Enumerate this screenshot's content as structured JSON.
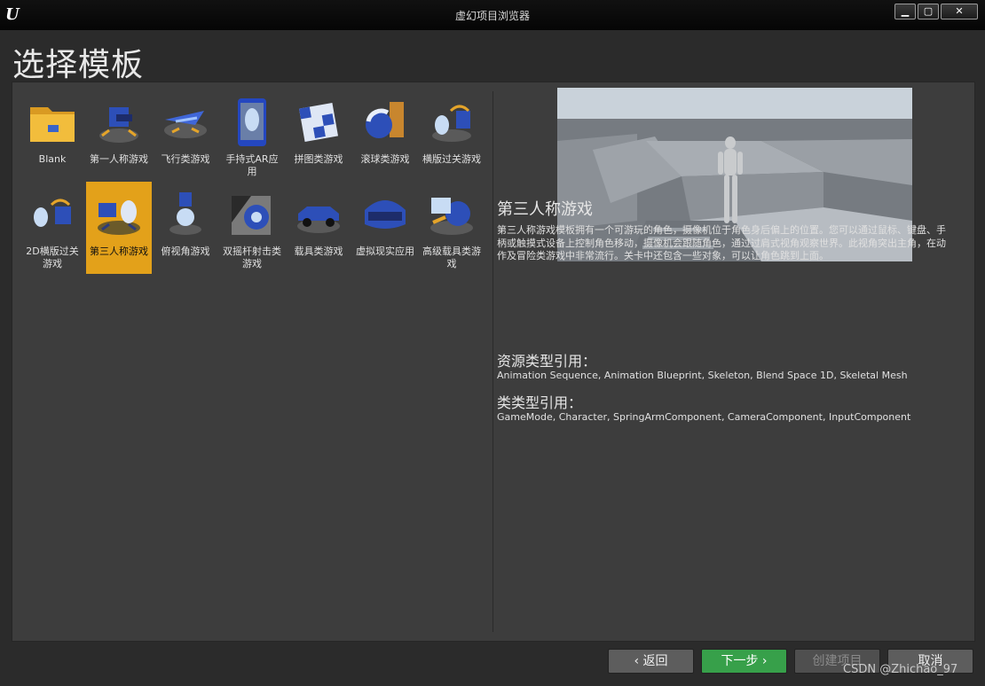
{
  "window": {
    "logo": "U",
    "title": "虚幻项目浏览器",
    "controls": {
      "minimize": "▁",
      "maximize": "▢",
      "close": "✕"
    }
  },
  "page_heading": "选择模板",
  "templates": [
    {
      "label": "Blank",
      "icon": "folder-icon"
    },
    {
      "label": "第一人称游戏",
      "icon": "first-person-icon"
    },
    {
      "label": "飞行类游戏",
      "icon": "flying-icon"
    },
    {
      "label": "手持式AR应用",
      "icon": "handheld-ar-icon"
    },
    {
      "label": "拼图类游戏",
      "icon": "puzzle-icon"
    },
    {
      "label": "滚球类游戏",
      "icon": "rolling-ball-icon"
    },
    {
      "label": "横版过关游戏",
      "icon": "side-scroller-icon"
    },
    {
      "label": "2D横版过关游戏",
      "icon": "2d-side-scroller-icon"
    },
    {
      "label": "第三人称游戏",
      "icon": "third-person-icon",
      "selected": true
    },
    {
      "label": "俯视角游戏",
      "icon": "top-down-icon"
    },
    {
      "label": "双摇杆射击类游戏",
      "icon": "twin-stick-icon"
    },
    {
      "label": "载具类游戏",
      "icon": "vehicle-icon"
    },
    {
      "label": "虚拟现实应用",
      "icon": "vr-headset-icon"
    },
    {
      "label": "高级载具类游戏",
      "icon": "advanced-vehicle-icon"
    }
  ],
  "detail": {
    "title": "第三人称游戏",
    "description": "第三人称游戏模板拥有一个可游玩的角色，摄像机位于角色身后偏上的位置。您可以通过鼠标、键盘、手柄或触摸式设备上控制角色移动，摄像机会跟随角色，通过过肩式视角观察世界。此视角突出主角，在动作及冒险类游戏中非常流行。关卡中还包含一些对象，可以让角色跳到上面。",
    "asset_heading": "资源类型引用：",
    "asset_types": "Animation Sequence, Animation Blueprint, Skeleton, Blend Space 1D, Skeletal Mesh",
    "class_heading": "类类型引用：",
    "class_types": "GameMode, Character, SpringArmComponent, CameraComponent, InputComponent"
  },
  "buttons": {
    "back": "‹ 返回",
    "next": "下一步 ›",
    "create": "创建项目",
    "cancel": "取消"
  },
  "watermark": "CSDN @Zhichao_97",
  "colors": {
    "selected_tile": "#e3a11a",
    "next_button": "#37a04a",
    "panel_bg": "#3d3d3d",
    "window_bg": "#2b2b2b"
  }
}
